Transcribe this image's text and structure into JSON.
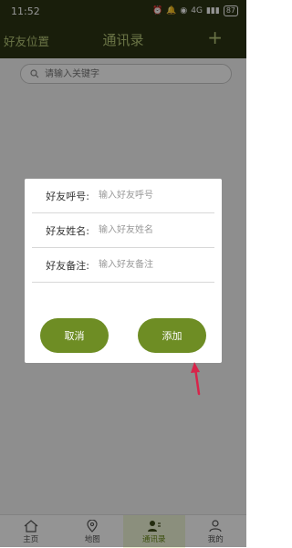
{
  "status_bar": {
    "time": "11:52",
    "signal_text": "4G",
    "battery": "87"
  },
  "header": {
    "left_label": "好友位置",
    "title": "通讯录",
    "add_symbol": "+"
  },
  "search": {
    "placeholder": "请输入关键字"
  },
  "dialog": {
    "fields": [
      {
        "label": "好友呼号:",
        "placeholder": "输入好友呼号"
      },
      {
        "label": "好友姓名:",
        "placeholder": "输入好友姓名"
      },
      {
        "label": "好友备注:",
        "placeholder": "输入好友备注"
      }
    ],
    "cancel_label": "取消",
    "add_label": "添加"
  },
  "bottom_nav": {
    "items": [
      {
        "label": "主页",
        "icon": "home-icon"
      },
      {
        "label": "地图",
        "icon": "map-pin-icon"
      },
      {
        "label": "通讯录",
        "icon": "contacts-icon"
      },
      {
        "label": "我的",
        "icon": "person-icon"
      }
    ],
    "active_index": 2
  },
  "colors": {
    "header_bg": "#2b3514",
    "accent": "#6e8d24",
    "annotation_arrow": "#d8244a"
  }
}
